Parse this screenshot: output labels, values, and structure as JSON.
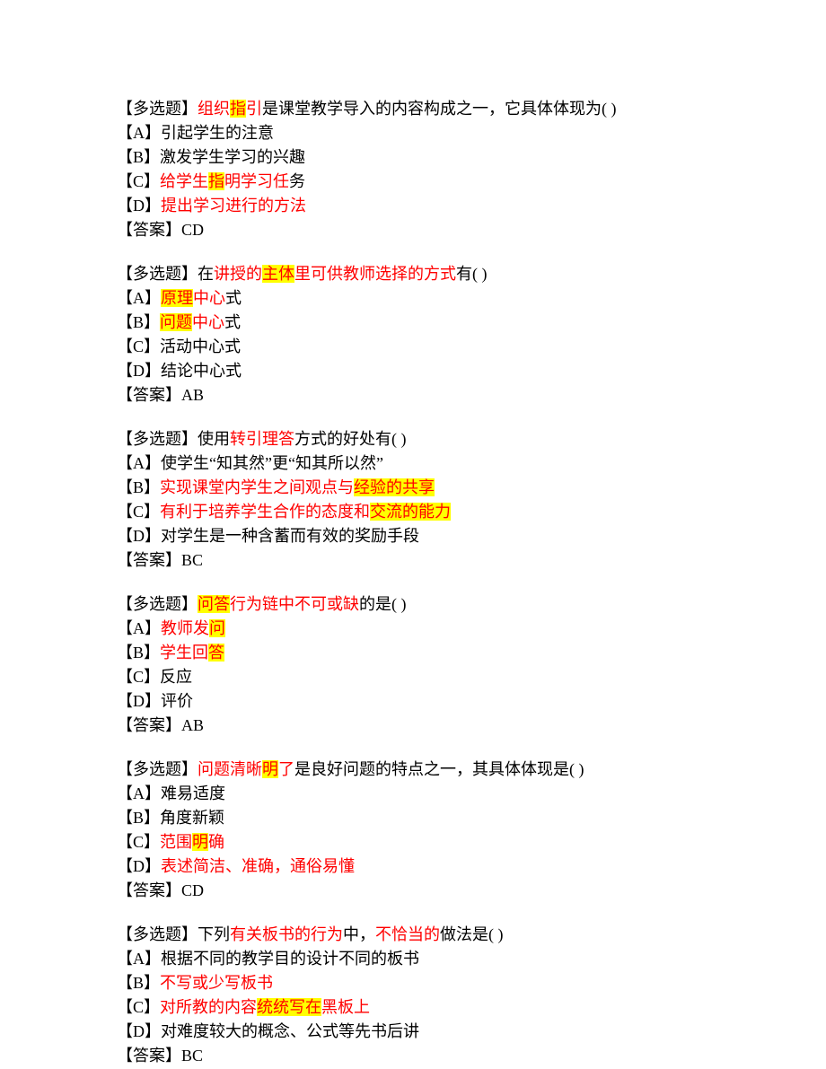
{
  "questions": [
    {
      "stem_parts": [
        {
          "text": "【多选题】",
          "red": false,
          "hl": false
        },
        {
          "text": "组织",
          "red": true,
          "hl": false
        },
        {
          "text": "指",
          "red": true,
          "hl": true
        },
        {
          "text": "引",
          "red": true,
          "hl": false
        },
        {
          "text": "是课堂教学导入的内容构成之一，它具体体现为( )",
          "red": false,
          "hl": false
        }
      ],
      "options": [
        [
          {
            "text": "【A】引起学生的注意",
            "red": false,
            "hl": false
          }
        ],
        [
          {
            "text": "【B】激发学生学习的兴趣",
            "red": false,
            "hl": false
          }
        ],
        [
          {
            "text": "【C】",
            "red": false,
            "hl": false
          },
          {
            "text": "给学生",
            "red": true,
            "hl": false
          },
          {
            "text": "指",
            "red": true,
            "hl": true
          },
          {
            "text": "明学习任",
            "red": true,
            "hl": false
          },
          {
            "text": "务",
            "red": false,
            "hl": false
          }
        ],
        [
          {
            "text": "【D】",
            "red": false,
            "hl": false
          },
          {
            "text": "提出学习进行的方法",
            "red": true,
            "hl": false
          }
        ]
      ],
      "answer_label": "【答案】",
      "answer_value": "CD"
    },
    {
      "stem_parts": [
        {
          "text": "【多选题】在",
          "red": false,
          "hl": false
        },
        {
          "text": "讲授的",
          "red": true,
          "hl": false
        },
        {
          "text": "主体",
          "red": true,
          "hl": true
        },
        {
          "text": "里可供教师选择的方式",
          "red": true,
          "hl": false
        },
        {
          "text": "有( )",
          "red": false,
          "hl": false
        }
      ],
      "options": [
        [
          {
            "text": "【A】",
            "red": false,
            "hl": false
          },
          {
            "text": "原理",
            "red": true,
            "hl": true
          },
          {
            "text": "中心",
            "red": true,
            "hl": false
          },
          {
            "text": "式",
            "red": false,
            "hl": false
          }
        ],
        [
          {
            "text": "【B】",
            "red": false,
            "hl": false
          },
          {
            "text": "问题",
            "red": true,
            "hl": true
          },
          {
            "text": "中心",
            "red": true,
            "hl": false
          },
          {
            "text": "式",
            "red": false,
            "hl": false
          }
        ],
        [
          {
            "text": "【C】活动中心式",
            "red": false,
            "hl": false
          }
        ],
        [
          {
            "text": "【D】结论中心式",
            "red": false,
            "hl": false
          }
        ]
      ],
      "answer_label": "【答案】",
      "answer_value": "AB"
    },
    {
      "stem_parts": [
        {
          "text": "【多选题】使用",
          "red": false,
          "hl": false
        },
        {
          "text": "转引理答",
          "red": true,
          "hl": false
        },
        {
          "text": "方式的好处有( )",
          "red": false,
          "hl": false
        }
      ],
      "options": [
        [
          {
            "text": "【A】使学生“知其然”更“知其所以然”",
            "red": false,
            "hl": false
          }
        ],
        [
          {
            "text": "【B】",
            "red": false,
            "hl": false
          },
          {
            "text": "实现课堂内学生之间观点与",
            "red": true,
            "hl": false
          },
          {
            "text": "经验的共享",
            "red": true,
            "hl": true
          }
        ],
        [
          {
            "text": "【C】",
            "red": false,
            "hl": false
          },
          {
            "text": "有利于培养学生合作的态度和",
            "red": true,
            "hl": false
          },
          {
            "text": "交流的能力",
            "red": true,
            "hl": true
          }
        ],
        [
          {
            "text": "【D】对学生是一种含蓄而有效的奖励手段",
            "red": false,
            "hl": false
          }
        ]
      ],
      "answer_label": "【答案】",
      "answer_value": "BC"
    },
    {
      "stem_parts": [
        {
          "text": "【多选题】",
          "red": false,
          "hl": false
        },
        {
          "text": "问答",
          "red": true,
          "hl": true
        },
        {
          "text": "行为链中不可或缺",
          "red": true,
          "hl": false
        },
        {
          "text": "的是( )",
          "red": false,
          "hl": false
        }
      ],
      "options": [
        [
          {
            "text": "【A】",
            "red": false,
            "hl": false
          },
          {
            "text": "教师发",
            "red": true,
            "hl": false
          },
          {
            "text": "问",
            "red": true,
            "hl": true
          }
        ],
        [
          {
            "text": "【B】",
            "red": false,
            "hl": false
          },
          {
            "text": "学生回",
            "red": true,
            "hl": false
          },
          {
            "text": "答",
            "red": true,
            "hl": true
          }
        ],
        [
          {
            "text": "【C】反应",
            "red": false,
            "hl": false
          }
        ],
        [
          {
            "text": "【D】评价",
            "red": false,
            "hl": false
          }
        ]
      ],
      "answer_label": "【答案】",
      "answer_value": "AB"
    },
    {
      "stem_parts": [
        {
          "text": "【多选题】",
          "red": false,
          "hl": false
        },
        {
          "text": "问题清晰",
          "red": true,
          "hl": false
        },
        {
          "text": "明",
          "red": true,
          "hl": true
        },
        {
          "text": "了",
          "red": true,
          "hl": false
        },
        {
          "text": "是良好问题的特点之一，其具体体现是( )",
          "red": false,
          "hl": false
        }
      ],
      "options": [
        [
          {
            "text": "【A】难易适度",
            "red": false,
            "hl": false
          }
        ],
        [
          {
            "text": "【B】角度新颖",
            "red": false,
            "hl": false
          }
        ],
        [
          {
            "text": "【C】",
            "red": false,
            "hl": false
          },
          {
            "text": "范围",
            "red": true,
            "hl": false
          },
          {
            "text": "明",
            "red": true,
            "hl": true
          },
          {
            "text": "确",
            "red": true,
            "hl": false
          }
        ],
        [
          {
            "text": "【D】",
            "red": false,
            "hl": false
          },
          {
            "text": "表述简洁、准确，通俗易懂",
            "red": true,
            "hl": false
          }
        ]
      ],
      "answer_label": "【答案】",
      "answer_value": "CD"
    },
    {
      "stem_parts": [
        {
          "text": "【多选题】下列",
          "red": false,
          "hl": false
        },
        {
          "text": "有关板书的行为",
          "red": true,
          "hl": false
        },
        {
          "text": "中，",
          "red": false,
          "hl": false
        },
        {
          "text": "不恰当的",
          "red": true,
          "hl": false
        },
        {
          "text": "做法是( )",
          "red": false,
          "hl": false
        }
      ],
      "options": [
        [
          {
            "text": "【A】根据不同的教学目的设计不同的板书",
            "red": false,
            "hl": false
          }
        ],
        [
          {
            "text": "【B】",
            "red": false,
            "hl": false
          },
          {
            "text": "不写或少写板书",
            "red": true,
            "hl": false
          }
        ],
        [
          {
            "text": "【C】",
            "red": false,
            "hl": false
          },
          {
            "text": "对所教的内容",
            "red": true,
            "hl": false
          },
          {
            "text": "统统写在",
            "red": true,
            "hl": true
          },
          {
            "text": "黑板上",
            "red": true,
            "hl": false
          }
        ],
        [
          {
            "text": "【D】对难度较大的概念、公式等先书后讲",
            "red": false,
            "hl": false
          }
        ]
      ],
      "answer_label": "【答案】",
      "answer_value": "BC"
    }
  ]
}
